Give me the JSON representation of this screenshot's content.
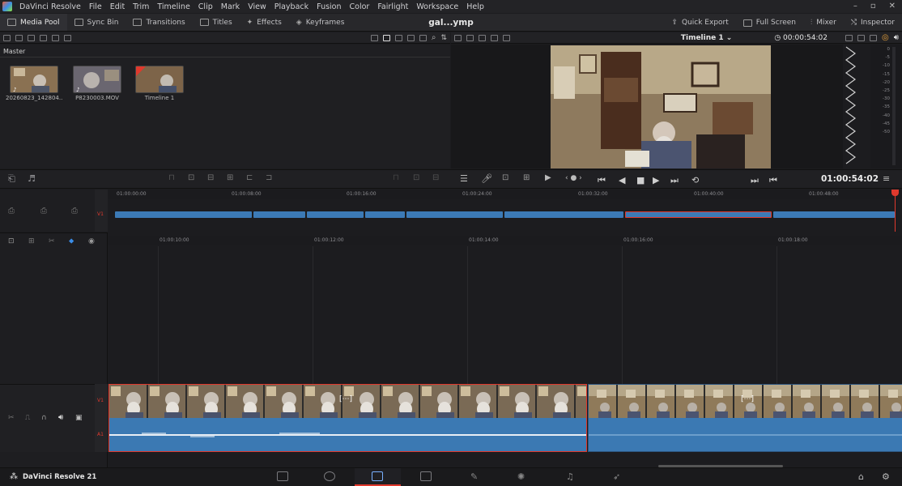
{
  "app": {
    "title": "DaVinci Resolve",
    "brand": "DaVinci Resolve 21",
    "project_title": "gal...ymp"
  },
  "menu": [
    "File",
    "Edit",
    "Trim",
    "Timeline",
    "Clip",
    "Mark",
    "View",
    "Playback",
    "Fusion",
    "Color",
    "Fairlight",
    "Workspace",
    "Help"
  ],
  "toolbar": {
    "left": [
      "Media Pool",
      "Sync Bin",
      "Transitions",
      "Titles",
      "Effects",
      "Keyframes"
    ],
    "right": [
      "Quick Export",
      "Full Screen",
      "Mixer",
      "Inspector"
    ]
  },
  "media_pool": {
    "bin": "Master",
    "items": [
      {
        "label": "20260823_142804..."
      },
      {
        "label": "P8230003.MOV"
      },
      {
        "label": "Timeline 1"
      }
    ]
  },
  "viewer": {
    "timeline_name": "Timeline 1",
    "duration": "00:00:54:02",
    "timecode": "01:00:54:02"
  },
  "audio_meter": {
    "scale": [
      "0",
      "-5",
      "-10",
      "-15",
      "-20",
      "-25",
      "-30",
      "-35",
      "-40",
      "-45",
      "-50"
    ]
  },
  "upper_ruler": [
    "01:00:00:00",
    "01:00:08:00",
    "01:00:16:00",
    "01:00:24:00",
    "01:00:32:00",
    "01:00:40:00",
    "01:00:48:00"
  ],
  "lower_ruler": [
    "01:00:10:00",
    "01:00:12:00",
    "01:00:14:00",
    "01:00:16:00",
    "01:00:18:00"
  ],
  "tracks": {
    "v1": "V1",
    "a1": "A1"
  },
  "colors": {
    "accent_red": "#e0392d",
    "clip_blue": "#3c7ab6",
    "panel": "#1f1f22"
  }
}
